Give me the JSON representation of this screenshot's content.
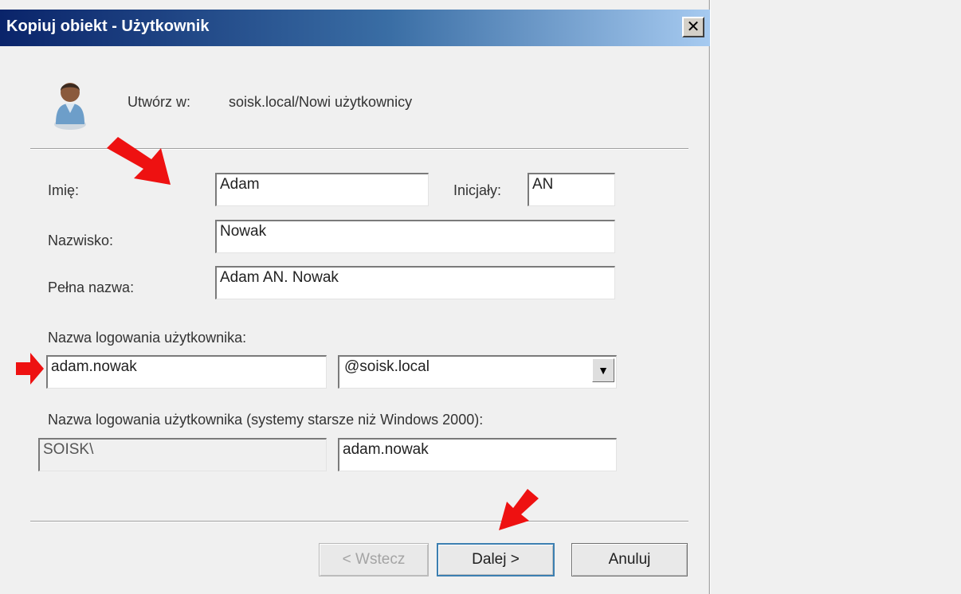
{
  "window": {
    "title": "Kopiuj obiekt - Użytkownik",
    "close_glyph": "✕"
  },
  "header": {
    "create_in_label": "Utwórz w:",
    "create_in_path": "soisk.local/Nowi użytkownicy"
  },
  "form": {
    "first_name_label": "Imię:",
    "first_name_value": "Adam",
    "initials_label": "Inicjały:",
    "initials_value": "AN",
    "last_name_label": "Nazwisko:",
    "last_name_value": "Nowak",
    "full_name_label": "Pełna nazwa:",
    "full_name_value": "Adam AN. Nowak",
    "logon_label": "Nazwa logowania użytkownika:",
    "logon_value": "adam.nowak",
    "domain_value": "@soisk.local",
    "legacy_label": "Nazwa logowania użytkownika (systemy starsze niż Windows 2000):",
    "legacy_domain_value": "SOISK\\",
    "legacy_logon_value": "adam.nowak"
  },
  "buttons": {
    "back": "< Wstecz",
    "next": "Dalej >",
    "cancel": "Anuluj"
  },
  "icons": {
    "user": "user-icon",
    "dropdown": "chevron-down-icon",
    "annotation": "red-arrow-icon"
  },
  "colors": {
    "titlebar_start": "#0a246a",
    "titlebar_end": "#a6caf0",
    "annotation": "#ee1111"
  }
}
